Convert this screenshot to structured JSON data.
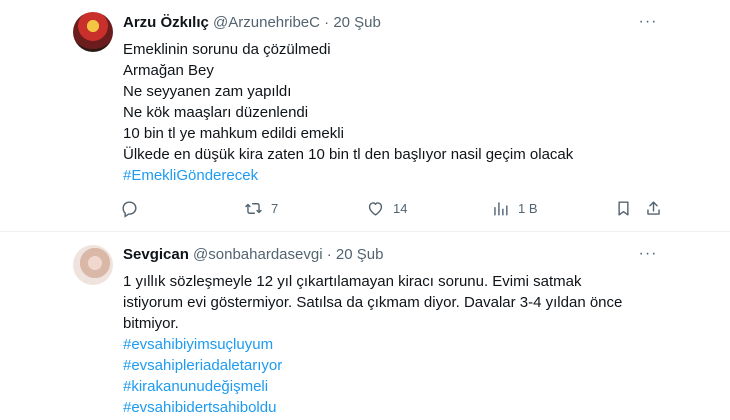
{
  "tweets": [
    {
      "name": "Arzu Özkılıç",
      "handle": "@ArzunehribeC",
      "dot": "·",
      "date": "20 Şub",
      "more": "···",
      "lines": [
        "Emeklinin sorunu da çözülmedi",
        "Armağan Bey",
        "Ne seyyanen zam yapıldı",
        "Ne kök maaşları düzenlendi",
        "10 bin tl ye mahkum edildi emekli",
        "Ülkede en düşük kira zaten 10 bin tl den başlıyor nasil geçim olacak"
      ],
      "hashtags": [
        "#EmekliGönderecek"
      ],
      "actions": {
        "reply_count": "",
        "retweet_count": "7",
        "like_count": "14",
        "views_count": "1 B"
      }
    },
    {
      "name": "Sevgican",
      "handle": "@sonbahardasevgi",
      "dot": "·",
      "date": "20 Şub",
      "more": "···",
      "lines": [
        "1 yıllık sözleşmeyle 12 yıl çıkartılamayan kiracı sorunu. Evimi satmak",
        "istiyorum evi göstermiyor. Satılsa da çıkmam diyor. Davalar 3-4 yıldan önce",
        "bitmiyor."
      ],
      "hashtags": [
        "#evsahibiyimsuçluyum",
        "#evsahipleriadaletarıyor",
        "#kirakanunudeğişmeli",
        "#evsahibidertsahiboldu"
      ]
    }
  ],
  "icons": {
    "reply": "reply-icon",
    "retweet": "retweet-icon",
    "like": "heart-icon",
    "views": "views-icon",
    "bookmark": "bookmark-icon",
    "share": "share-icon"
  },
  "colors": {
    "link": "#1d9bf0",
    "muted": "#536471",
    "text": "#0f1419",
    "divider": "#eff3f4"
  }
}
